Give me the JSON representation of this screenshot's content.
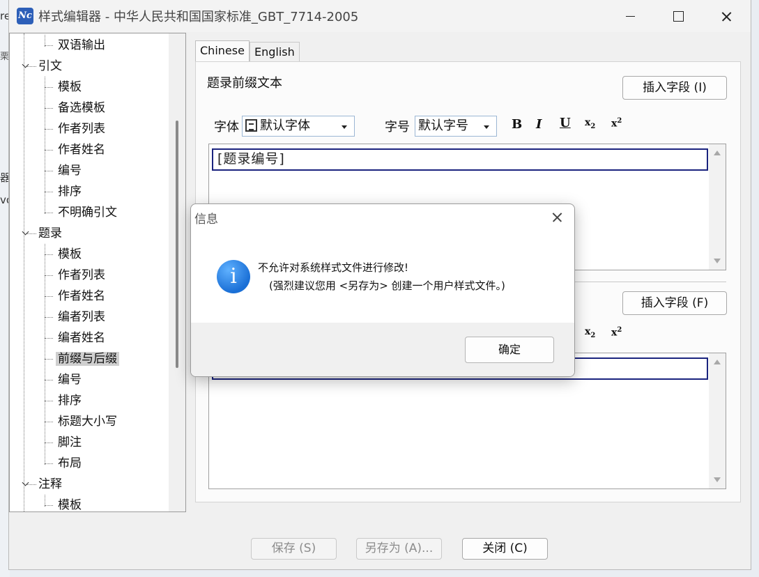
{
  "background": {
    "frag1": "re",
    "frag2": "栗",
    "frag3": "器",
    "frag4": "vo"
  },
  "window": {
    "title": "样式编辑器 - 中华人民共和国国家标准_GBT_7714-2005",
    "icon_text": "Nc"
  },
  "tree": {
    "items": [
      {
        "label": "双语输出",
        "level": 1
      },
      {
        "label": "引文",
        "level": 0
      },
      {
        "label": "模板",
        "level": 1
      },
      {
        "label": "备选模板",
        "level": 1
      },
      {
        "label": "作者列表",
        "level": 1
      },
      {
        "label": "作者姓名",
        "level": 1
      },
      {
        "label": "编号",
        "level": 1
      },
      {
        "label": "排序",
        "level": 1
      },
      {
        "label": "不明确引文",
        "level": 1
      },
      {
        "label": "题录",
        "level": 0
      },
      {
        "label": "模板",
        "level": 1
      },
      {
        "label": "作者列表",
        "level": 1
      },
      {
        "label": "作者姓名",
        "level": 1
      },
      {
        "label": "编者列表",
        "level": 1
      },
      {
        "label": "编者姓名",
        "level": 1
      },
      {
        "label": "前缀与后缀",
        "level": 1,
        "selected": true
      },
      {
        "label": "编号",
        "level": 1
      },
      {
        "label": "排序",
        "level": 1
      },
      {
        "label": "标题大小写",
        "level": 1
      },
      {
        "label": "脚注",
        "level": 1
      },
      {
        "label": "布局",
        "level": 1
      },
      {
        "label": "注释",
        "level": 0
      },
      {
        "label": "模板",
        "level": 1
      }
    ]
  },
  "tabs": [
    {
      "label": "Chinese"
    },
    {
      "label": "English"
    }
  ],
  "prefix": {
    "label": "题录前缀文本",
    "insert_button": "插入字段 (I)",
    "font_label": "字体",
    "font_value": "默认字体",
    "size_label": "字号",
    "size_value": "默认字号",
    "field_text": "[题录编号]"
  },
  "suffix": {
    "insert_button": "插入字段 (F)"
  },
  "format": {
    "bold": "B",
    "italic": "I",
    "underline": "U",
    "sub": "x",
    "sup": "x",
    "sub_mark": "2",
    "sup_mark": "2"
  },
  "footer": {
    "save": "保存 (S)",
    "save_as": "另存为 (A)...",
    "close": "关闭 (C)"
  },
  "dialog": {
    "title": "信息",
    "icon": "i",
    "line1": "不允许对系统样式文件进行修改!",
    "line2": "(强烈建议您用 <另存为> 创建一个用户样式文件。)",
    "ok": "确定"
  }
}
